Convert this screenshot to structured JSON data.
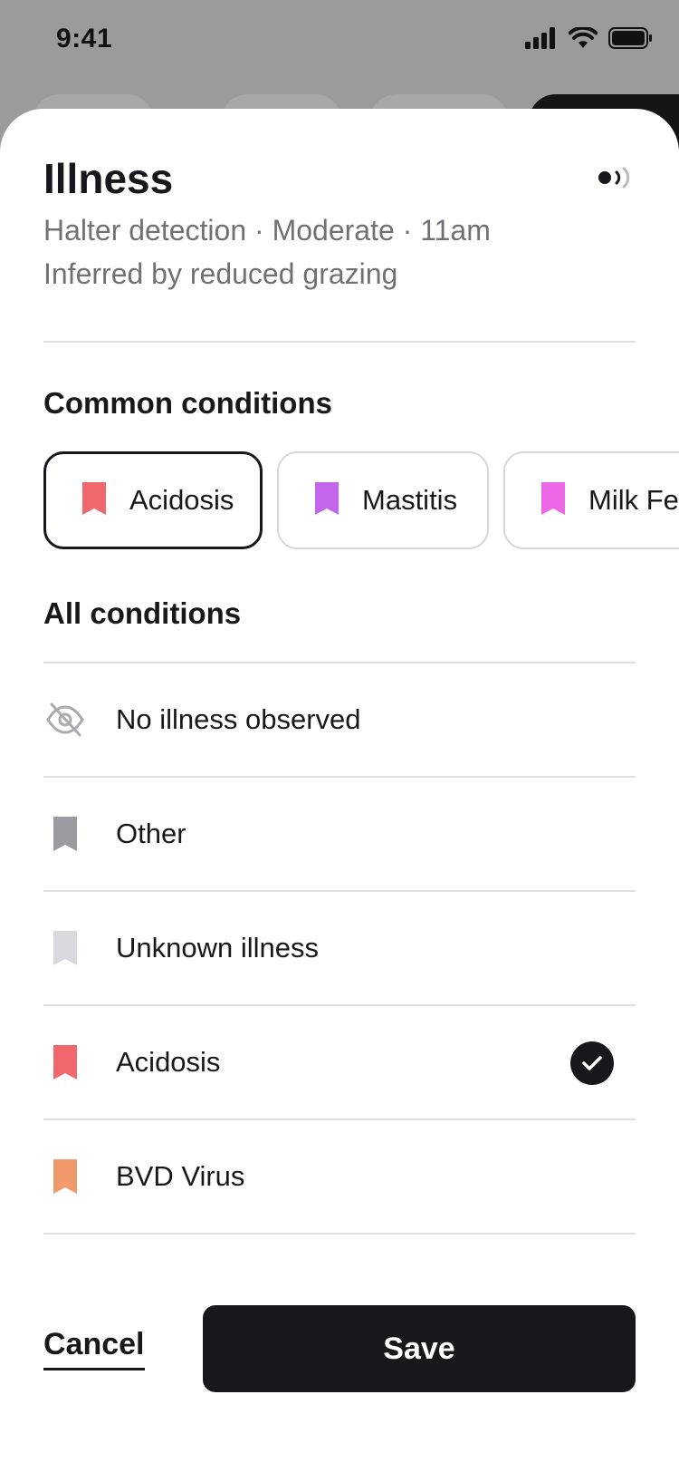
{
  "status_bar": {
    "time": "9:41"
  },
  "header": {
    "title": "Illness",
    "subtitle_line1": "Halter detection · Moderate · 11am",
    "subtitle_line2": "Inferred by reduced grazing",
    "signal_icon": "signal-icon"
  },
  "common": {
    "heading": "Common conditions",
    "chips": [
      {
        "label": "Acidosis",
        "color": "#f0686b",
        "selected": true
      },
      {
        "label": "Mastitis",
        "color": "#c266ec",
        "selected": false
      },
      {
        "label": "Milk Fever",
        "color": "#ec67e6",
        "selected": false
      }
    ]
  },
  "all": {
    "heading": "All conditions",
    "items": [
      {
        "label": "No illness observed",
        "icon": "eye-slash-icon",
        "color": "#a9abb0",
        "checked": false
      },
      {
        "label": "Other",
        "icon": "bookmark-icon",
        "color": "#9a9ca1",
        "checked": false
      },
      {
        "label": "Unknown illness",
        "icon": "bookmark-icon",
        "color": "#d8d9dc",
        "checked": false
      },
      {
        "label": "Acidosis",
        "icon": "bookmark-icon",
        "color": "#f0686b",
        "checked": true
      },
      {
        "label": "BVD Virus",
        "icon": "bookmark-icon",
        "color": "#f0996a",
        "checked": false
      }
    ]
  },
  "footer": {
    "cancel_label": "Cancel",
    "save_label": "Save"
  },
  "colors": {
    "primary": "#17181b",
    "divider": "#dedfe1",
    "secondary_text": "#6f7176"
  }
}
